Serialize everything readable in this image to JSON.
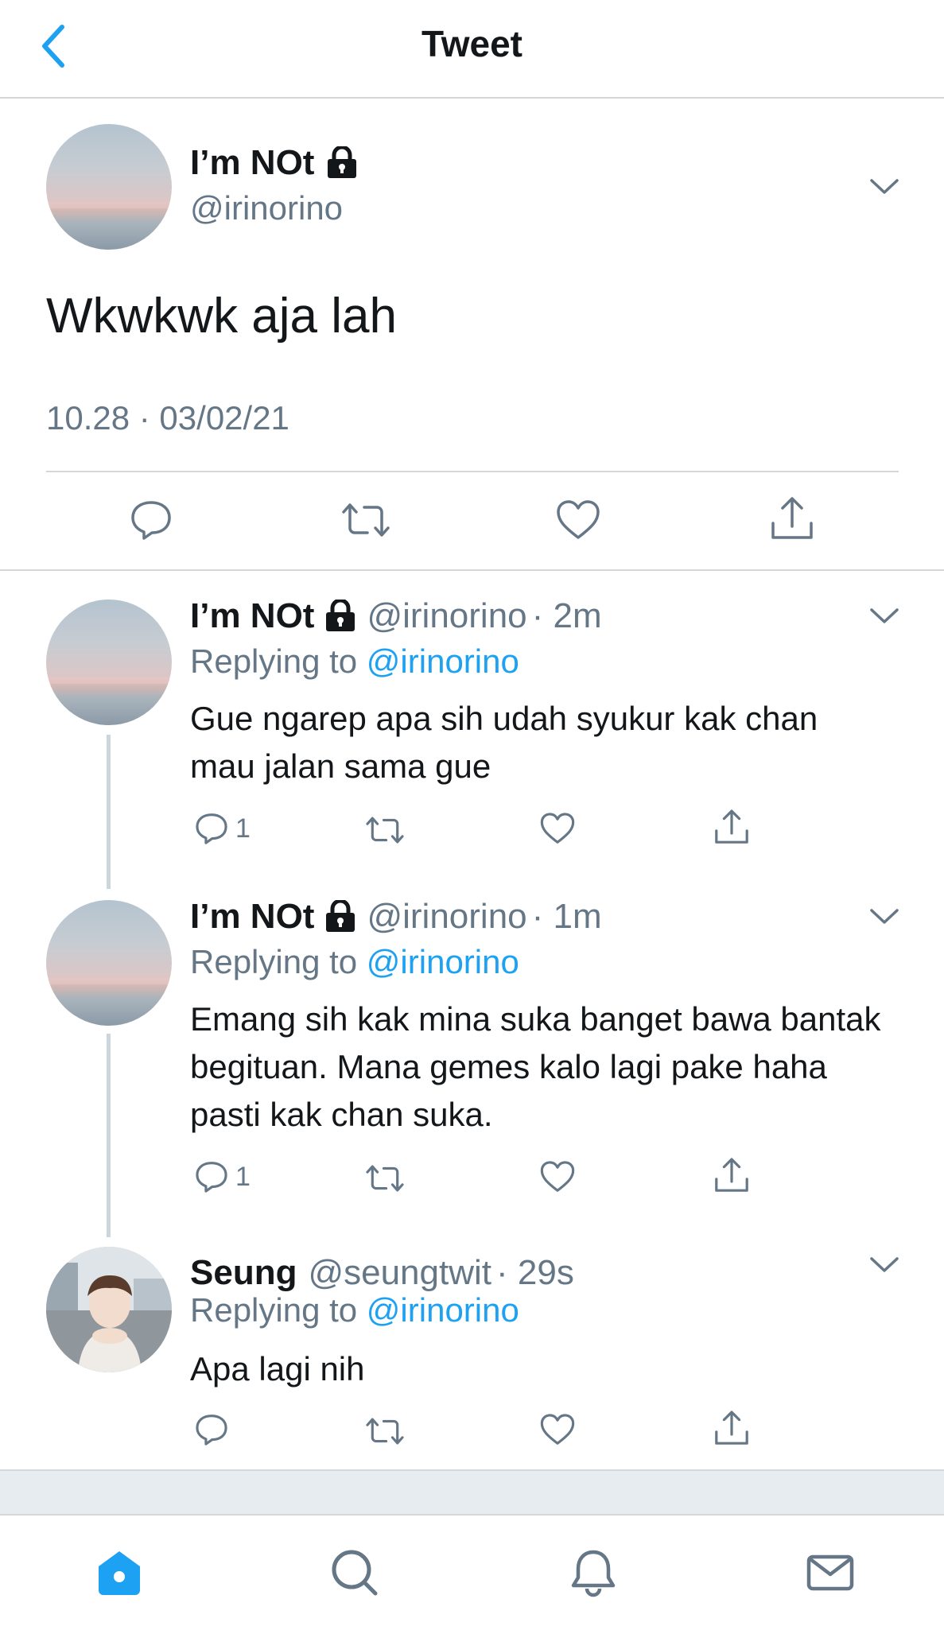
{
  "header": {
    "title": "Tweet"
  },
  "main_tweet": {
    "name": "I’m NOt",
    "handle": "@irinorino",
    "text": "Wkwkwk aja lah",
    "timestamp": "10.28 · 03/02/21"
  },
  "replies": [
    {
      "name": "I’m NOt",
      "handle": "@irinorino",
      "time": "· 2m",
      "replying_prefix": "Replying to ",
      "replying_to": "@irinorino",
      "text": "Gue ngarep apa sih udah syukur kak chan mau jalan sama gue",
      "reply_count": "1"
    },
    {
      "name": "I’m NOt",
      "handle": "@irinorino",
      "time": "· 1m",
      "replying_prefix": "Replying to ",
      "replying_to": "@irinorino",
      "text": "Emang sih kak mina suka banget bawa bantak begituan. Mana gemes kalo lagi pake haha pasti kak chan suka.",
      "reply_count": "1"
    },
    {
      "name": "Seung",
      "handle": "@seungtwit",
      "time": "· 29s",
      "replying_prefix": "Replying to ",
      "replying_to": "@irinorino",
      "text": "Apa lagi nih",
      "reply_count": ""
    }
  ],
  "colors": {
    "accent": "#1da1f2",
    "muted": "#657786",
    "icon": "#657786",
    "text": "#14171a"
  },
  "tabbar": {
    "items": [
      "home-icon",
      "search-icon",
      "notifications-icon",
      "messages-icon"
    ],
    "active": "home-icon"
  }
}
